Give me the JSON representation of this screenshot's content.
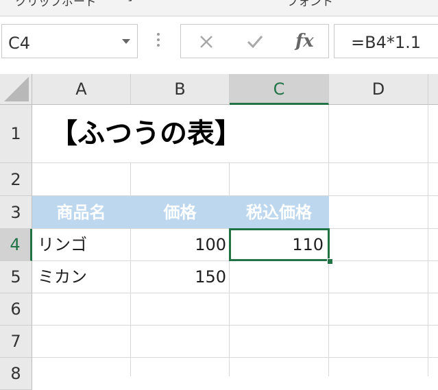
{
  "ribbon": {
    "group_clipboard": "クリップボード",
    "group_font": "フォント"
  },
  "formula_bar": {
    "name_box": "C4",
    "fx": "fx",
    "formula": "=B4*1.1"
  },
  "columns": [
    "A",
    "B",
    "C",
    "D"
  ],
  "selected_column": "C",
  "rows": [
    "1",
    "2",
    "3",
    "4",
    "5",
    "6",
    "7",
    "8"
  ],
  "selected_row": "4",
  "cells": {
    "A1": "【ふつうの表】",
    "A3": "商品名",
    "B3": "価格",
    "C3": "税込価格",
    "A4": "リンゴ",
    "B4": "100",
    "C4": "110",
    "A5": "ミカン",
    "B5": "150"
  },
  "colors": {
    "accent": "#217346",
    "header_fill": "#bdd7ee",
    "header_text": "#ffffff"
  }
}
